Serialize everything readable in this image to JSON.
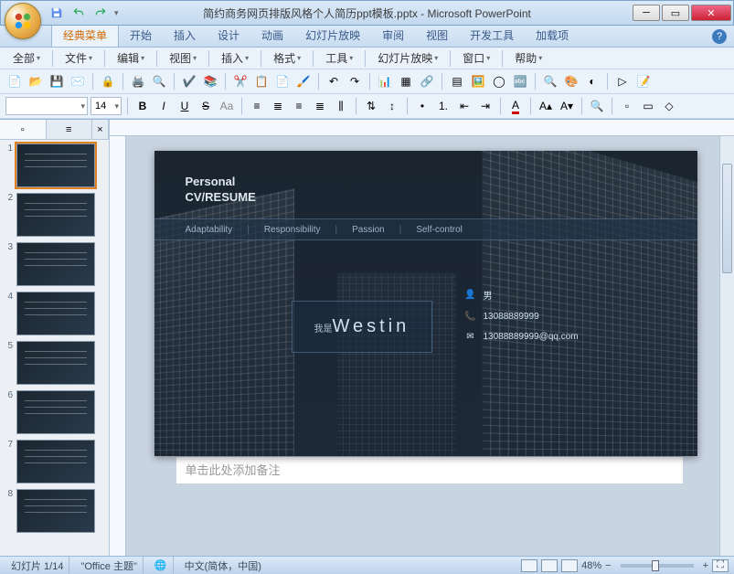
{
  "window": {
    "title": "简约商务网页排版风格个人简历ppt模板.pptx - Microsoft PowerPoint"
  },
  "qat": {
    "save": "💾",
    "undo": "↶",
    "redo": "↷"
  },
  "ribbon_tabs": [
    "经典菜单",
    "开始",
    "插入",
    "设计",
    "动画",
    "幻灯片放映",
    "审阅",
    "视图",
    "开发工具",
    "加载项"
  ],
  "menus": [
    "全部",
    "文件",
    "编辑",
    "视图",
    "插入",
    "格式",
    "工具",
    "幻灯片放映",
    "窗口",
    "帮助"
  ],
  "font": {
    "size": "14"
  },
  "thumbs": {
    "count": 8
  },
  "slide": {
    "title_line1": "Personal",
    "title_line2": "CV/RESUME",
    "traits": [
      "Adaptability",
      "Responsibility",
      "Passion",
      "Self-control"
    ],
    "name_prefix": "我是",
    "name": "Westin",
    "contact": {
      "gender": "男",
      "phone": "13088889999",
      "email": "13088889999@qq.com"
    }
  },
  "notes_placeholder": "单击此处添加备注",
  "status": {
    "slide_pos": "幻灯片 1/14",
    "theme": "\"Office 主题\"",
    "lang": "中文(简体，中国)",
    "zoom": "48%"
  }
}
